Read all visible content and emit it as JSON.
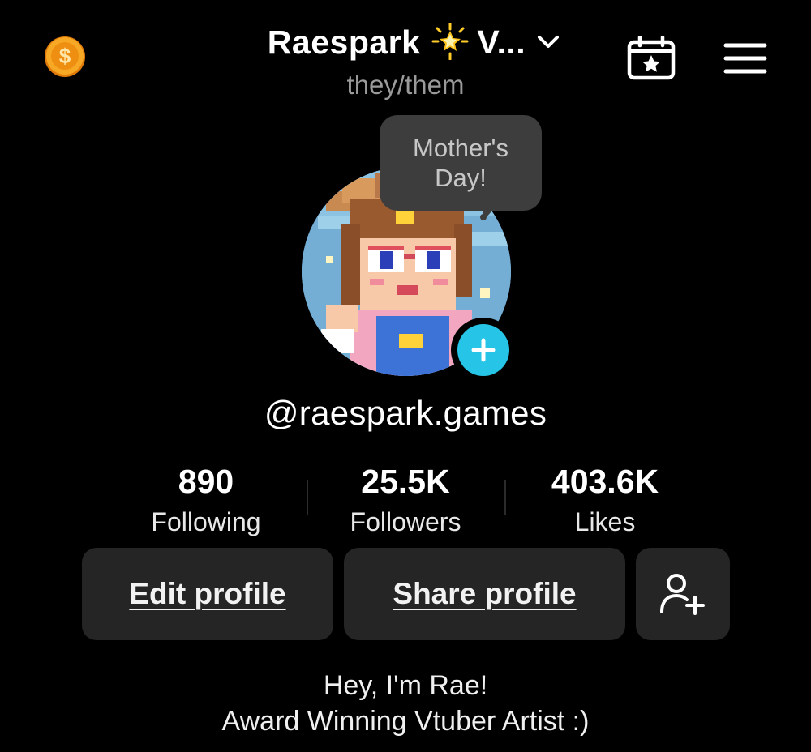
{
  "header": {
    "title": "Raespark",
    "title_suffix": "V...",
    "star_icon": "glowing-star-emoji",
    "pronouns": "they/them",
    "coin_icon": "gold-coin-dollar-icon",
    "calendar_icon": "calendar-star-icon",
    "menu_icon": "hamburger-menu-icon"
  },
  "tooltip": {
    "text": "Mother's Day!"
  },
  "profile": {
    "avatar": "pixel-art-avatar",
    "add_icon": "plus-icon",
    "username": "@raespark.games"
  },
  "stats": [
    {
      "value": "890",
      "label": "Following"
    },
    {
      "value": "25.5K",
      "label": "Followers"
    },
    {
      "value": "403.6K",
      "label": "Likes"
    }
  ],
  "actions": {
    "edit_profile": "Edit profile",
    "share_profile": "Share profile",
    "add_friend_icon": "add-user-icon"
  },
  "bio": {
    "line1": "Hey, I'm Rae!",
    "line2": "Award Winning Vtuber Artist :)"
  },
  "colors": {
    "background": "#000000",
    "button": "#252525",
    "accent_cyan": "#26c4e6",
    "coin_gold": "#f5a623",
    "tooltip_bg": "#3d3d3d"
  }
}
